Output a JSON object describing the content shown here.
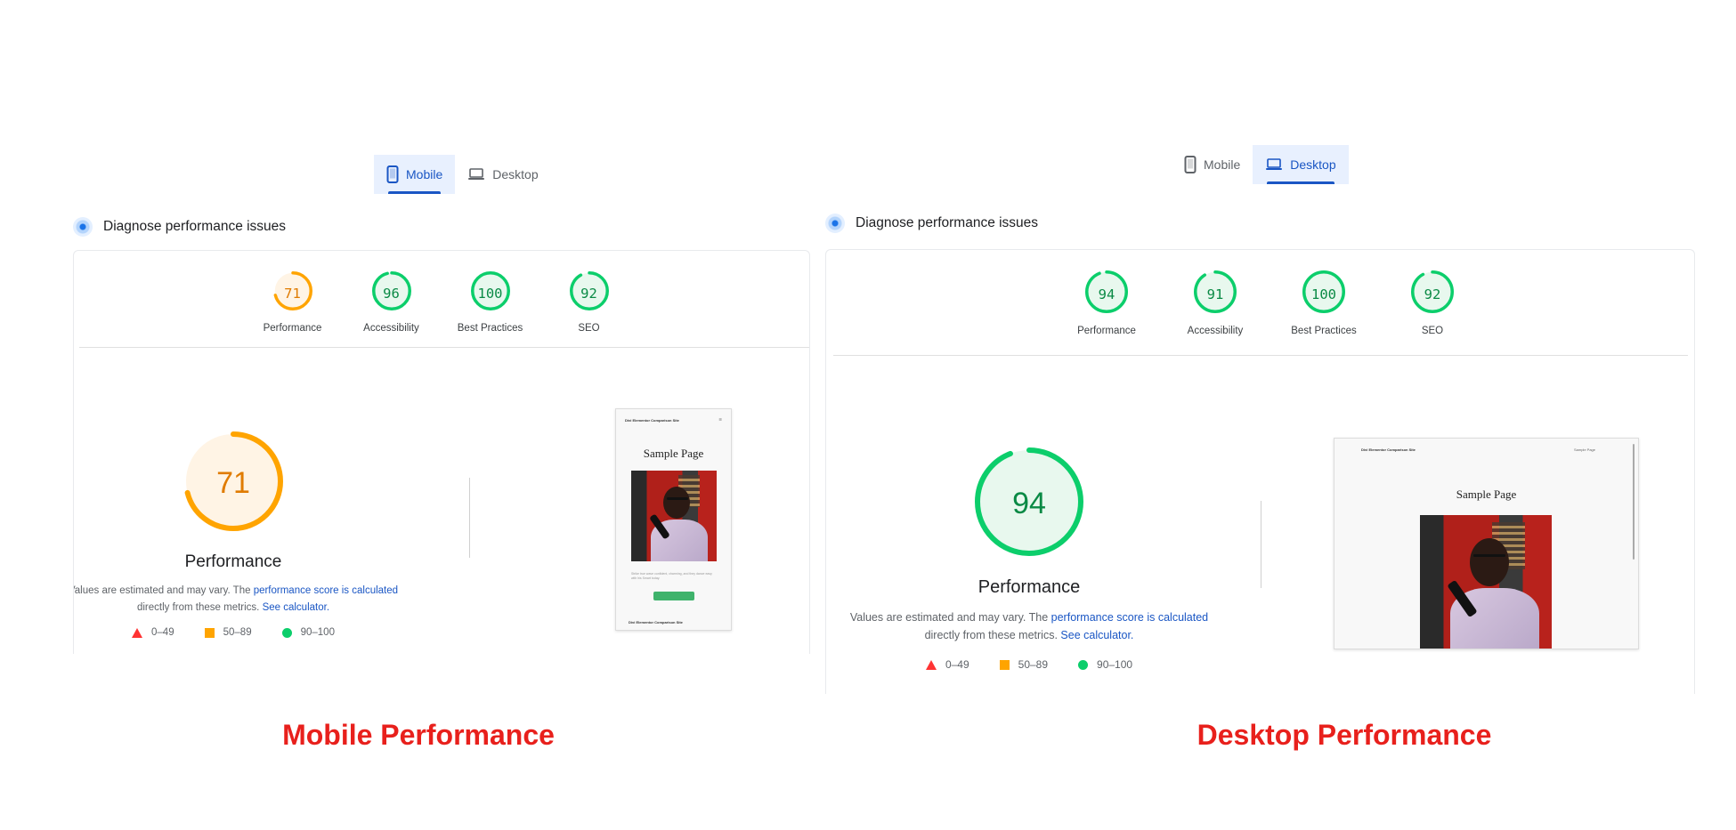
{
  "colors": {
    "accent": "#1a56c4",
    "pass": "#0cce6b",
    "average": "#ffa400",
    "fail": "#ff3333",
    "caption": "#e8201c"
  },
  "panels": [
    {
      "tabs": [
        {
          "label": "Mobile",
          "icon": "phone-icon",
          "active": true
        },
        {
          "label": "Desktop",
          "icon": "laptop-icon",
          "active": false
        }
      ],
      "diagnose_label": "Diagnose performance issues",
      "categories": [
        {
          "label": "Performance",
          "score": 71,
          "status": "average"
        },
        {
          "label": "Accessibility",
          "score": 96,
          "status": "pass"
        },
        {
          "label": "Best Practices",
          "score": 100,
          "status": "pass"
        },
        {
          "label": "SEO",
          "score": 92,
          "status": "pass"
        }
      ],
      "main_score": 71,
      "main_status": "average",
      "main_title": "Performance",
      "note_prefix": "Values are estimated and may vary. The ",
      "note_link1": "performance score is calculated",
      "note_middle": " directly from these metrics. ",
      "note_link2": "See calculator.",
      "legend": [
        {
          "shape": "triangle",
          "label": "0–49"
        },
        {
          "shape": "square",
          "label": "50–89"
        },
        {
          "shape": "circle",
          "label": "90–100"
        }
      ],
      "screenshot": {
        "site_name": "Divi Elementor Comparison Site",
        "menu": "☰",
        "page_title": "Sample Page",
        "caption": "Strike true wave confident, charming, and they dance easy with his Smart today.",
        "footer": "Divi Elementor Comparison Site"
      },
      "caption": "Mobile Performance"
    },
    {
      "tabs": [
        {
          "label": "Mobile",
          "icon": "phone-icon",
          "active": false
        },
        {
          "label": "Desktop",
          "icon": "laptop-icon",
          "active": true
        }
      ],
      "diagnose_label": "Diagnose performance issues",
      "categories": [
        {
          "label": "Performance",
          "score": 94,
          "status": "pass"
        },
        {
          "label": "Accessibility",
          "score": 91,
          "status": "pass"
        },
        {
          "label": "Best Practices",
          "score": 100,
          "status": "pass"
        },
        {
          "label": "SEO",
          "score": 92,
          "status": "pass"
        }
      ],
      "main_score": 94,
      "main_status": "pass",
      "main_title": "Performance",
      "note_prefix": "Values are estimated and may vary. The ",
      "note_link1": "performance score is calculated",
      "note_middle": " directly from these metrics. ",
      "note_link2": "See calculator.",
      "legend": [
        {
          "shape": "triangle",
          "label": "0–49"
        },
        {
          "shape": "square",
          "label": "50–89"
        },
        {
          "shape": "circle",
          "label": "90–100"
        }
      ],
      "screenshot": {
        "site_name": "Divi Elementor Comparison Site",
        "menu": "Sample Page",
        "page_title": "Sample Page"
      },
      "caption": "Desktop Performance"
    }
  ]
}
